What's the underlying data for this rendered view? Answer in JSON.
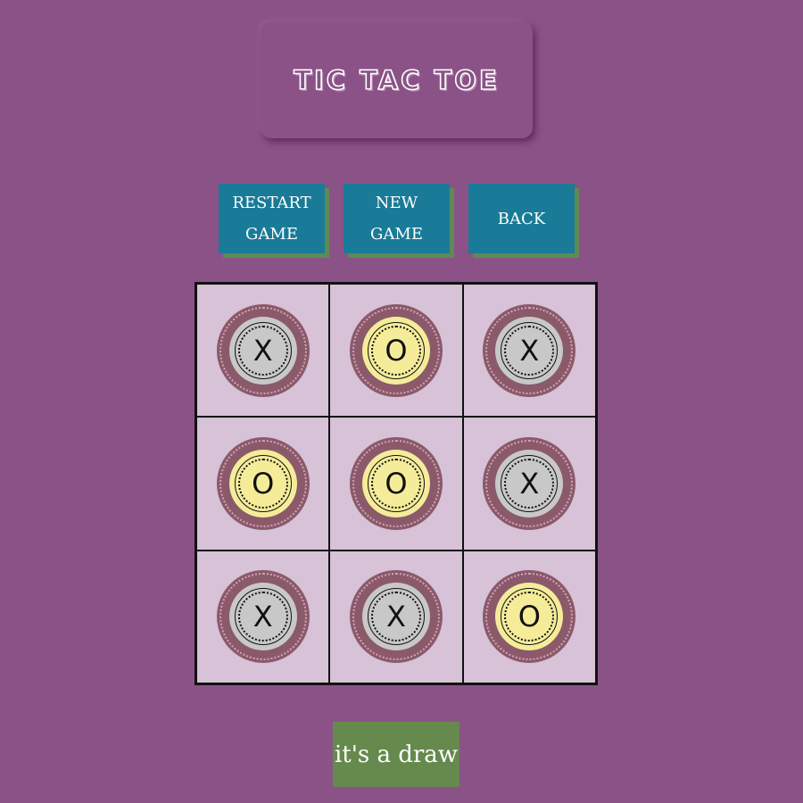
{
  "title": "TIC TAC TOE",
  "buttons": {
    "restart_line1": "RESTART",
    "restart_line2": "GAME",
    "new_game": "NEW GAME",
    "back": "BACK"
  },
  "board": {
    "cells": [
      "X",
      "O",
      "X",
      "O",
      "O",
      "X",
      "X",
      "X",
      "O"
    ]
  },
  "status": "it's a draw",
  "colors": {
    "background": "#8a5287",
    "button": "#197b97",
    "button_shadow": "#5d8a55",
    "board": "#d7c2d7",
    "x_coin": "#c8c8c8",
    "o_coin": "#f5ec9a",
    "status_bg": "#66894d"
  }
}
